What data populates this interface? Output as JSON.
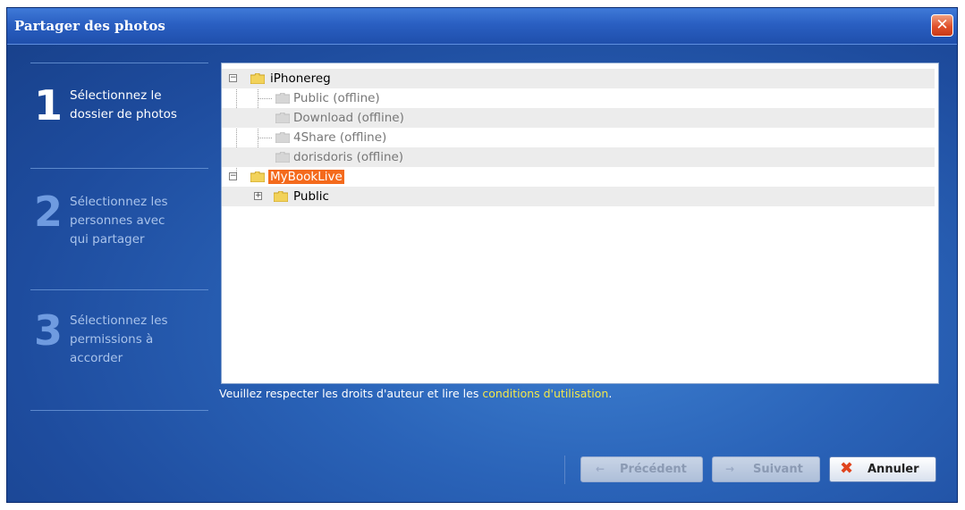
{
  "window": {
    "title": "Partager des photos",
    "close_symbol": "✕"
  },
  "steps": [
    {
      "number": "1",
      "text_lines": [
        "Sélectionnez le",
        "dossier de photos"
      ],
      "active": true
    },
    {
      "number": "2",
      "text_lines": [
        "Sélectionnez les",
        "personnes avec",
        "qui partager"
      ],
      "active": false
    },
    {
      "number": "3",
      "text_lines": [
        "Sélectionnez les",
        "permissions à",
        "accorder"
      ],
      "active": false
    }
  ],
  "tree": {
    "nodes": [
      {
        "label": "iPhonereg",
        "expander": "−",
        "status": "normal"
      },
      {
        "label": "Public (offline)",
        "status": "offline"
      },
      {
        "label": "Download (offline)",
        "status": "offline"
      },
      {
        "label": "4Share (offline)",
        "status": "offline"
      },
      {
        "label": "dorisdoris (offline)",
        "status": "offline"
      },
      {
        "label": "MyBookLive",
        "expander": "−",
        "status": "selected"
      },
      {
        "label": "Public",
        "expander": "+",
        "status": "normal"
      }
    ]
  },
  "notice": {
    "prefix": "Veuillez respecter les droits d'auteur et lire les ",
    "link": "conditions d'utilisation",
    "suffix": "."
  },
  "buttons": {
    "previous": "Précédent",
    "next": "Suivant",
    "cancel": "Annuler"
  },
  "colors": {
    "selection": "#f46a1c",
    "link": "#f4e84a",
    "window_bg": "#2a63b8"
  }
}
